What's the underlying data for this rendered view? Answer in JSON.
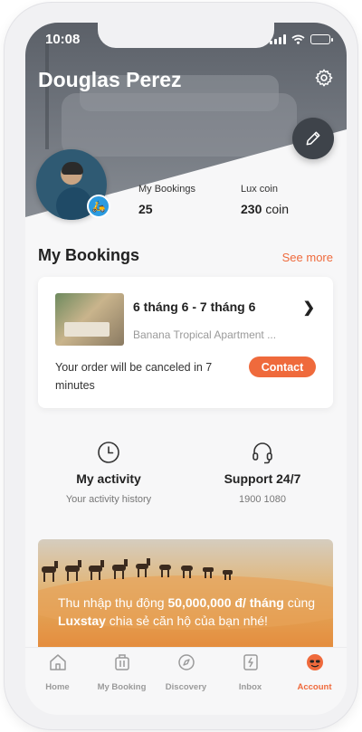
{
  "status_bar": {
    "time": "10:08"
  },
  "profile": {
    "name": "Douglas Perez",
    "stats": [
      {
        "label": "My Bookings",
        "value": "25",
        "unit": ""
      },
      {
        "label": "Lux coin",
        "value": "230",
        "unit": "coin"
      }
    ]
  },
  "bookings": {
    "title": "My Bookings",
    "see_more": "See more",
    "card": {
      "dates": "6 tháng 6 - 7 tháng 6",
      "name": "Banana Tropical Apartment ...",
      "warning": "Your order will be canceled in 7 minutes",
      "contact": "Contact"
    }
  },
  "quick_actions": [
    {
      "title": "My activity",
      "subtitle": "Your activity history",
      "icon": "clock-icon"
    },
    {
      "title": "Support 24/7",
      "subtitle": "1900 1080",
      "icon": "headset-icon"
    }
  ],
  "promo": {
    "text_before": "Thu nhập thụ động ",
    "amount": "50,000,000 đ/ tháng",
    "text_middle": " cùng ",
    "brand": "Luxstay",
    "text_after": " chia sẻ căn hộ của bạn nhé!"
  },
  "tabs": [
    {
      "label": "Home",
      "icon": "home-icon"
    },
    {
      "label": "My Booking",
      "icon": "luggage-icon"
    },
    {
      "label": "Discovery",
      "icon": "compass-icon"
    },
    {
      "label": "Inbox",
      "icon": "inbox-icon"
    },
    {
      "label": "Account",
      "icon": "account-icon",
      "active": true
    }
  ],
  "colors": {
    "accent": "#ef6a3c",
    "header": "#5b6068"
  }
}
